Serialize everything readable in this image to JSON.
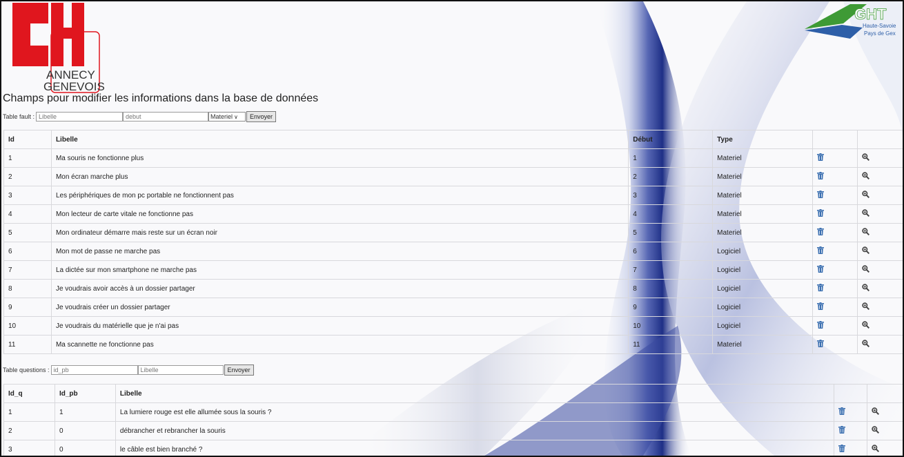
{
  "header": {
    "logo_left": "CH ANNECY GENEVOIS",
    "logo_right": "GHT Haute-Savoie Pays de Gex",
    "title": "Champs pour modifier les informations dans la base de données"
  },
  "form_fault": {
    "label": "Table fault :",
    "libelle_placeholder": "Libelle",
    "debut_placeholder": "debut",
    "type_selected": "Materiel",
    "submit": "Envoyer"
  },
  "table_fault": {
    "headers": [
      "Id",
      "Libelle",
      "Début",
      "Type",
      "",
      ""
    ],
    "rows": [
      {
        "id": "1",
        "libelle": "Ma souris ne fonctionne plus",
        "debut": "1",
        "type": "Materiel"
      },
      {
        "id": "2",
        "libelle": "Mon écran marche plus",
        "debut": "2",
        "type": "Materiel"
      },
      {
        "id": "3",
        "libelle": "Les périphériques de mon pc portable ne fonctionnent pas",
        "debut": "3",
        "type": "Materiel"
      },
      {
        "id": "4",
        "libelle": "Mon lecteur de carte vitale ne fonctionne pas",
        "debut": "4",
        "type": "Materiel"
      },
      {
        "id": "5",
        "libelle": "Mon ordinateur démarre mais reste sur un écran noir",
        "debut": "5",
        "type": "Materiel"
      },
      {
        "id": "6",
        "libelle": "Mon mot de passe ne marche pas",
        "debut": "6",
        "type": "Logiciel"
      },
      {
        "id": "7",
        "libelle": "La dictée sur mon smartphone ne marche pas",
        "debut": "7",
        "type": "Logiciel"
      },
      {
        "id": "8",
        "libelle": "Je voudrais avoir accès à un dossier partager",
        "debut": "8",
        "type": "Logiciel"
      },
      {
        "id": "9",
        "libelle": "Je voudrais créer un dossier partager",
        "debut": "9",
        "type": "Logiciel"
      },
      {
        "id": "10",
        "libelle": "Je voudrais du matérielle que je n'ai pas",
        "debut": "10",
        "type": "Logiciel"
      },
      {
        "id": "11",
        "libelle": "Ma scannette ne fonctionne pas",
        "debut": "11",
        "type": "Materiel"
      }
    ]
  },
  "form_questions": {
    "label": "Table questions :",
    "id_pb_placeholder": "id_pb",
    "libelle_placeholder": "Libelle",
    "submit": "Envoyer"
  },
  "table_questions": {
    "headers": [
      "Id_q",
      "Id_pb",
      "Libelle",
      "",
      ""
    ],
    "rows": [
      {
        "id_q": "1",
        "id_pb": "1",
        "libelle": "La lumiere rouge est elle allumée sous la souris ?"
      },
      {
        "id_q": "2",
        "id_pb": "0",
        "libelle": "débrancher et rebrancher la souris"
      },
      {
        "id_q": "3",
        "id_pb": "0",
        "libelle": "le câble est bien branché ?"
      }
    ]
  },
  "icons": {
    "delete": "trash-icon",
    "view": "magnifier-icon"
  },
  "colors": {
    "ch_red": "#e0161e",
    "ght_green": "#3e9a35",
    "ght_blue": "#2e5fa8",
    "trash_blue": "#3b6fb0"
  }
}
